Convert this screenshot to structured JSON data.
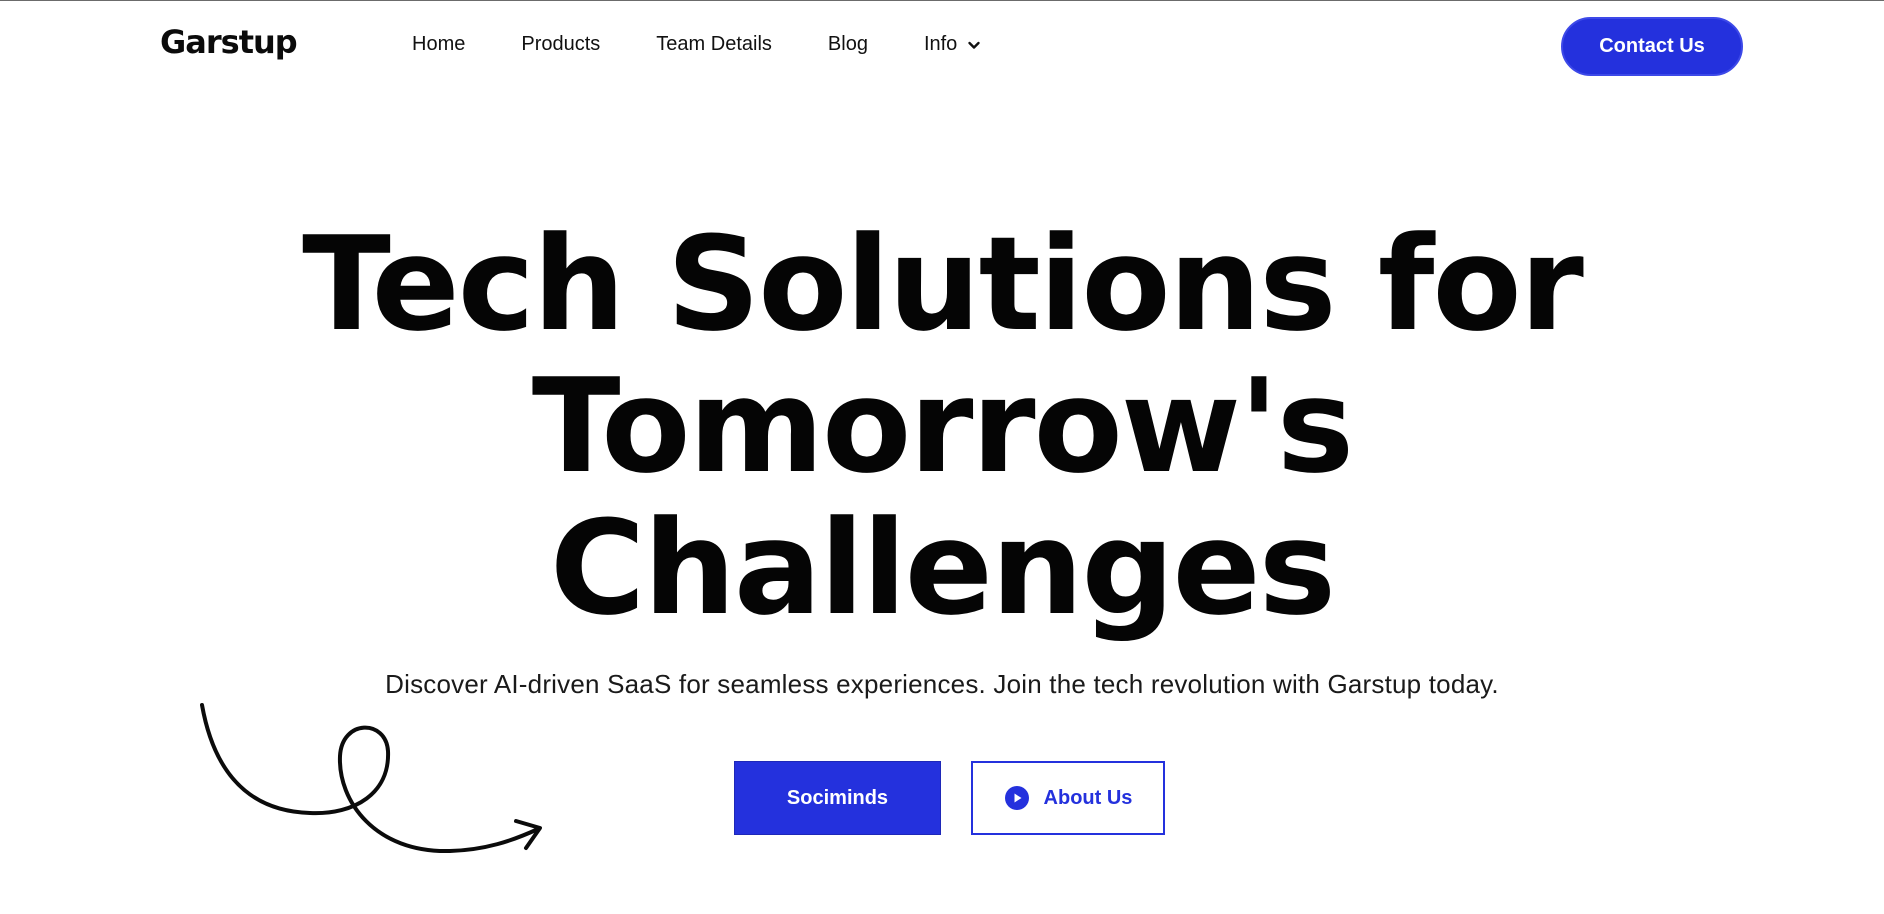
{
  "header": {
    "logo": "Garstup",
    "nav": [
      {
        "label": "Home"
      },
      {
        "label": "Products"
      },
      {
        "label": "Team Details"
      },
      {
        "label": "Blog"
      },
      {
        "label": "Info",
        "icon": "chevron-down-icon"
      }
    ],
    "contact_label": "Contact Us"
  },
  "hero": {
    "title_lines": [
      "Tech Solutions for",
      "Tomorrow's",
      "Challenges"
    ],
    "subtitle": "Discover AI-driven SaaS for seamless experiences. Join the tech revolution with Garstup today.",
    "primary_button": "Sociminds",
    "secondary_button": "About Us",
    "secondary_icon": "play-circle-icon",
    "decoration_icon": "curly-arrow-icon"
  },
  "colors": {
    "accent": "#2431dd",
    "text": "#050505",
    "background": "#ffffff"
  }
}
